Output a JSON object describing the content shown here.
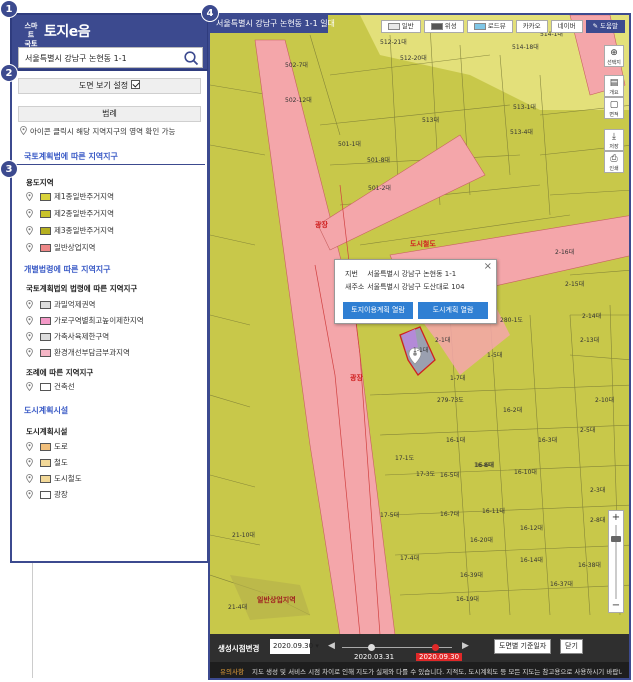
{
  "logo": {
    "mark": "스마트\n국토정보",
    "text": "토지e음"
  },
  "search": {
    "value": "서울특별시 강남구 논현동 1-1"
  },
  "badges": [
    "1",
    "2",
    "3",
    "4"
  ],
  "panel": {
    "view_setting_label": "도면 보기 설정",
    "legend_label": "범례",
    "hint": "아이콘 클릭시 해당 지역지구의 영역 확인 가능",
    "sec1_title": "국토계획법에 따른 지역지구",
    "zoning_title": "용도지역",
    "zoning_items": [
      {
        "label": "제1종일반주거지역",
        "color": "#d8d23a"
      },
      {
        "label": "제2종일반주거지역",
        "color": "#c8c22a"
      },
      {
        "label": "제3종일반주거지역",
        "color": "#b6b020"
      },
      {
        "label": "일반상업지역",
        "color": "#ee8888"
      }
    ],
    "sec2_title": "개별법령에 따른 지역지구",
    "national_title": "국토계획법외 법령에 따른 지역지구",
    "national_items": [
      {
        "label": "과밀억제권역",
        "color": "#dddddd"
      },
      {
        "label": "가로구역별최고높이제한지역",
        "color": "#f49ac8"
      },
      {
        "label": "가축사육제한구역",
        "color": "#dddddd"
      },
      {
        "label": "환경개선부담금부과지역",
        "color": "#f5b6c6"
      }
    ],
    "ordinance_title": "조례에 따른 지역지구",
    "ordinance_items": [
      {
        "label": "건축선",
        "color": "#ffffff"
      }
    ],
    "sec3_title": "도시계획시설",
    "facility_title": "도시계획시설",
    "facility_items": [
      {
        "label": "도로",
        "color": "#f2c07c"
      },
      {
        "label": "철도",
        "color": "#f2d898"
      },
      {
        "label": "도시철도",
        "color": "#f2d898"
      },
      {
        "label": "광장",
        "color": "#ffffff"
      }
    ]
  },
  "map": {
    "title": "서울특별시 강남구 논현동 1-1 일대",
    "toolbar": {
      "btn_general": "일반",
      "btn_satellite": "위성",
      "btn_roadview": "로드뷰",
      "btn_kakao": "카카오",
      "btn_naver": "네이버",
      "btn_help": "도움말"
    },
    "tools": {
      "expand": "선택지",
      "info": "개요",
      "area": "면적",
      "save": "저장",
      "print": "인쇄"
    },
    "lot_labels": [
      "514-18대",
      "514-1대",
      "512-21대",
      "512-20대",
      "502-7대",
      "502-12대",
      "513대",
      "513-4대",
      "513-1대",
      "501-1대",
      "501-8대",
      "501-2대",
      "2-16대",
      "2-15대",
      "2-14대",
      "2-13대",
      "280-1도",
      "1-5대",
      "1-7대",
      "279-73도",
      "16-1대",
      "16-2대",
      "16-3대",
      "16-8대",
      "16-10대",
      "17-1도",
      "17-3도",
      "16-7대",
      "16-11대",
      "17-4대",
      "16-12대",
      "16-19대",
      "16-39대",
      "16-37대",
      "21-10대",
      "21-4대",
      "1-1대",
      "2-1대",
      "16-6대",
      "16-5대",
      "2-5대",
      "2-10대",
      "17-5대",
      "16-14대",
      "16-20대",
      "16-38대",
      "2-3대",
      "2-8대"
    ],
    "red_labels": {
      "plaza1": "광장",
      "plaza2": "광장",
      "road": "도시철도",
      "commercial": "일반상업지역"
    },
    "popup": {
      "jibun_key": "지번",
      "jibun_val": "서울특별시 강남구 논현동 1-1",
      "road_key": "새주소",
      "road_val": "서울특별시 강남구 도산대로 104",
      "close": "×",
      "btn_land": "토지이용계획 열람",
      "btn_city": "도시계획 열람"
    },
    "timeline": {
      "label": "생성시점변경",
      "select_value": "2020.09.30",
      "prev": "◀",
      "next": "▶",
      "date1": "2020.03.31",
      "date2": "2020.09.30",
      "btn_base": "도면별 기준일자",
      "btn_close": "닫기"
    },
    "notice": {
      "tag": "유의사항",
      "text": "지도 생성 및 서비스 시점 차이로 인해 지도가 실제와 다를 수 있습니다. 지적도, 도시계획도 등 모든 지도는 참고용으로 사용하시기 바랍니다."
    }
  }
}
